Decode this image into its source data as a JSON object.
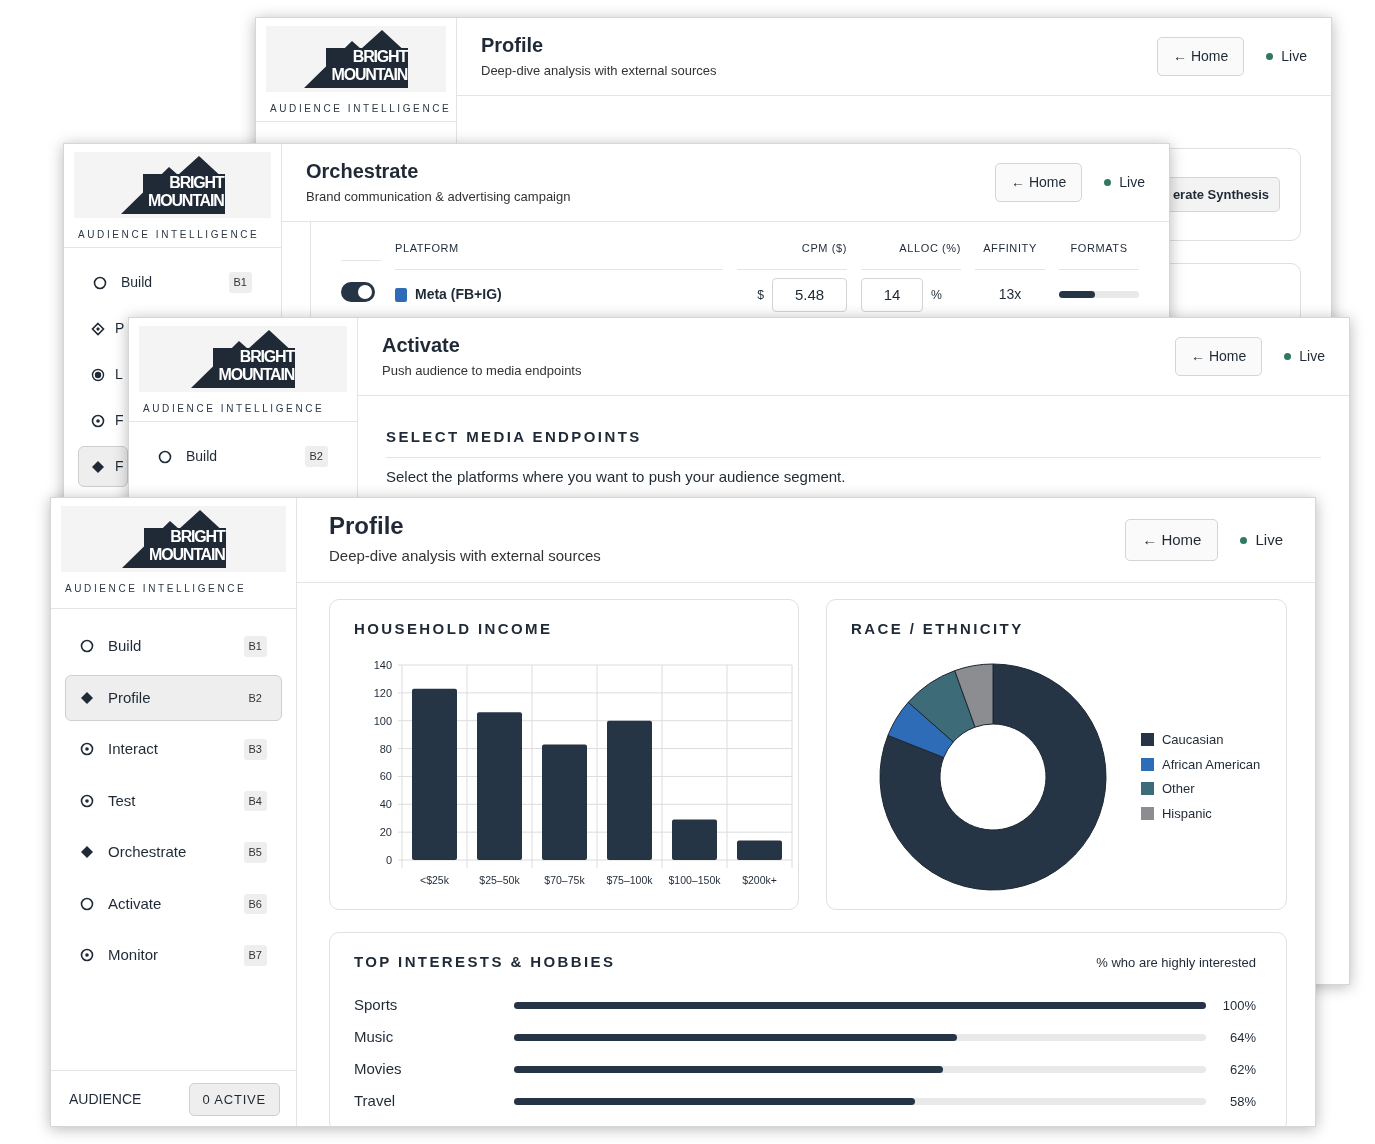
{
  "windows": [
    {
      "kind": "profile_back",
      "logo": {
        "name": "BRIGHT MOUNTAIN",
        "tagline": "AUDIENCE INTELLIGENCE"
      },
      "title": "Profile",
      "subtitle": "Deep-dive analysis with external sources",
      "home_button": "← Home",
      "status": "Live",
      "synthesis_button": "erate Synthesis"
    },
    {
      "kind": "orchestrate",
      "logo": {
        "name": "BRIGHT MOUNTAIN",
        "tagline": "AUDIENCE INTELLIGENCE"
      },
      "title": "Orchestrate",
      "subtitle": "Brand communication & advertising campaign",
      "home_button": "← Home",
      "status": "Live",
      "nav": [
        {
          "label": "Build",
          "badge": "B1",
          "kind": "ring",
          "selected": false
        },
        {
          "label": "P",
          "kind": "diamond-outline",
          "selected": false
        },
        {
          "label": "L",
          "kind": "dot",
          "selected": false
        },
        {
          "label": "F",
          "kind": "target",
          "selected": false
        },
        {
          "label": "F",
          "kind": "diamond",
          "selected": true
        }
      ],
      "table": {
        "columns": [
          "PLATFORM",
          "CPM ($)",
          "ALLOC (%)",
          "AFFINITY",
          "FORMATS"
        ],
        "rows": [
          {
            "on": true,
            "platform": "Meta (FB+IG)",
            "currency": "$",
            "cpm": "5.48",
            "alloc": "14",
            "unit": "%",
            "affinity": "13x",
            "level": 0.45
          }
        ]
      }
    },
    {
      "kind": "activate",
      "logo": {
        "name": "BRIGHT MOUNTAIN",
        "tagline": "AUDIENCE INTELLIGENCE"
      },
      "title": "Activate",
      "subtitle": "Push audience to media endpoints",
      "home_button": "← Home",
      "status": "Live",
      "nav": [
        {
          "label": "Build",
          "badge": "B2",
          "kind": "ring",
          "selected": false
        }
      ],
      "section_title": "SELECT MEDIA ENDPOINTS",
      "description": "Select the platforms where you want to push your audience segment."
    },
    {
      "kind": "profile",
      "logo": {
        "name": "BRIGHT MOUNTAIN",
        "tagline": "AUDIENCE INTELLIGENCE"
      },
      "title": "Profile",
      "subtitle": "Deep-dive analysis with external sources",
      "home_button": "← Home",
      "status": "Live",
      "nav": [
        {
          "label": "Build",
          "badge": "B1",
          "kind": "ring",
          "selected": false
        },
        {
          "label": "Profile",
          "badge": "B2",
          "kind": "diamond",
          "selected": true
        },
        {
          "label": "Interact",
          "badge": "B3",
          "kind": "target",
          "selected": false
        },
        {
          "label": "Test",
          "badge": "B4",
          "kind": "target",
          "selected": false
        },
        {
          "label": "Orchestrate",
          "badge": "B5",
          "kind": "diamond",
          "selected": false
        },
        {
          "label": "Activate",
          "badge": "B6",
          "kind": "ring",
          "selected": false
        },
        {
          "label": "Monitor",
          "badge": "B7",
          "kind": "target",
          "selected": false
        }
      ],
      "footer": {
        "label": "AUDIENCE",
        "button": "0 ACTIVE"
      },
      "income": {
        "title": "HOUSEHOLD INCOME",
        "chart_data": {
          "type": "bar",
          "categories": [
            "<$25k",
            "$25–50k",
            "$70–75k",
            "$75–100k",
            "$100–150k",
            "$200k+"
          ],
          "values": [
            123,
            106,
            83,
            100,
            29,
            14
          ],
          "ylim": [
            0,
            140
          ],
          "grid": true,
          "yticks": [
            0,
            20,
            40,
            60,
            80,
            100,
            120,
            140
          ]
        }
      },
      "race": {
        "title": "RACE / ETHNICITY",
        "legend": [
          {
            "label": "Caucasian",
            "color": "#263545"
          },
          {
            "label": "African American",
            "color": "#2f6cb8"
          },
          {
            "label": "Other",
            "color": "#3e6b78"
          },
          {
            "label": "Hispanic",
            "color": "#8b8d90"
          }
        ]
      },
      "interests": {
        "title": "TOP INTERESTS & HOBBIES",
        "note": "% who are highly interested",
        "rows": [
          {
            "label": "Sports",
            "level": 1.0,
            "reading": "100%"
          },
          {
            "label": "Music",
            "level": 0.64,
            "reading": "64%"
          },
          {
            "label": "Movies",
            "level": 0.62,
            "reading": "62%"
          },
          {
            "label": "Travel",
            "level": 0.58,
            "reading": "58%"
          }
        ]
      }
    }
  ]
}
